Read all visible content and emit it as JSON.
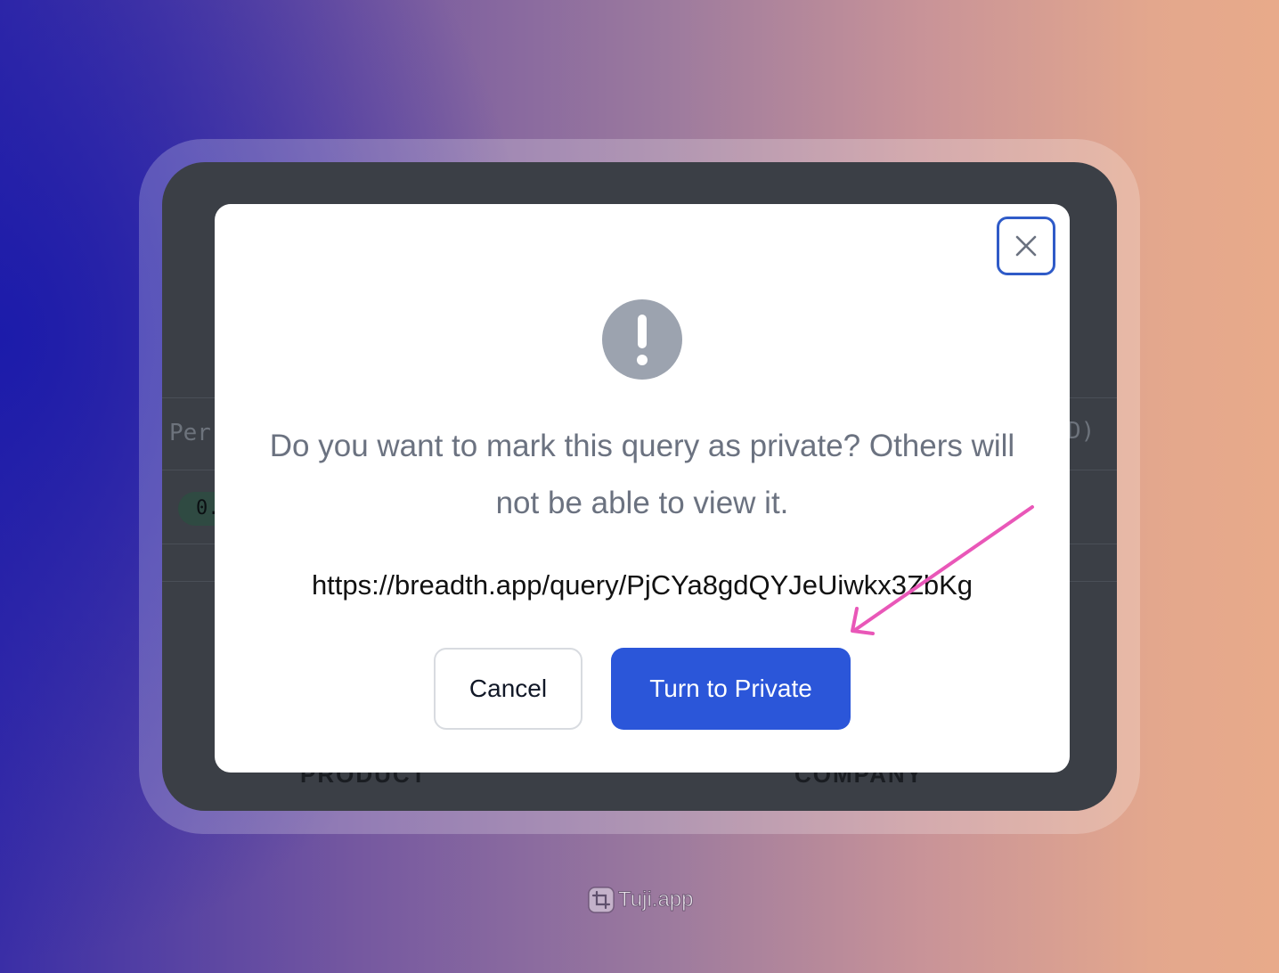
{
  "background_window": {
    "header_left_text": "Per",
    "header_right_text": "D)",
    "pill_text": "0.",
    "footer_left": "PRODUCT",
    "footer_right": "COMPANY"
  },
  "dialog": {
    "close_icon": "close-icon",
    "alert_icon": "exclamation-circle-icon",
    "message": "Do you want to mark this query as private? Others will not be able to view it.",
    "url": "https://breadth.app/query/PjCYa8gdQYJeUiwkx3ZbKg",
    "cancel_label": "Cancel",
    "confirm_label": "Turn to Private"
  },
  "annotation": {
    "type": "arrow",
    "color": "#e957b8",
    "points_to": "confirm-button"
  },
  "watermark": {
    "text": "Tuji.app",
    "icon": "crop-icon"
  },
  "colors": {
    "primary": "#2b56d9",
    "close_border": "#2f5bc8",
    "alert_icon_bg": "#9ca3af",
    "message_text": "#6b7280",
    "app_background": "#3b3f46"
  }
}
